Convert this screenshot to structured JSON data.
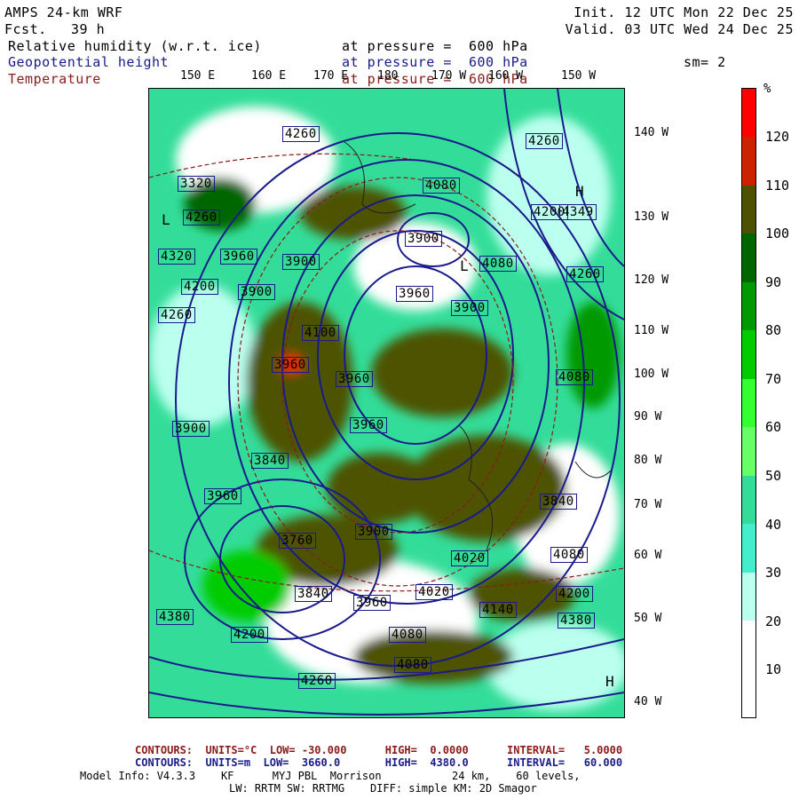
{
  "header": {
    "model": "AMPS 24-km WRF",
    "fcst_label": "Fcst.",
    "fcst_value": "39 h",
    "init": "Init. 12 UTC Mon 22 Dec 25",
    "valid": "Valid. 03 UTC Wed 24 Dec 25",
    "fields": [
      {
        "name": "Relative humidity (w.r.t. ice)",
        "level": "at pressure =  600 hPa",
        "color": "#000000"
      },
      {
        "name": "Geopotential height",
        "level": "at pressure =  600 hPa",
        "color": "#1a1a8c"
      },
      {
        "name": "Temperature",
        "level": "at pressure =  600 hPa",
        "color": "#8b1a1a"
      }
    ],
    "smoothing": "sm= 2"
  },
  "colorbar": {
    "unit": "%",
    "ticks": [
      "120",
      "110",
      "100",
      "90",
      "80",
      "70",
      "60",
      "50",
      "40",
      "30",
      "20",
      "10"
    ],
    "colors": [
      "#ff0000",
      "#cc2200",
      "#4d5200",
      "#006600",
      "#009900",
      "#00cc00",
      "#33ff33",
      "#66ff66",
      "#33dd99",
      "#44eecc",
      "#bbffee",
      "#ffffff",
      "#ffffff"
    ]
  },
  "map": {
    "lon_top": [
      "150 E",
      "160 E",
      "170 E",
      "180",
      "170 W",
      "160 W",
      "150 W"
    ],
    "lon_right": [
      "140 W",
      "130 W",
      "120 W",
      "110 W",
      "100 W",
      "90 W",
      "80 W",
      "70 W",
      "60 W",
      "50 W",
      "40 W"
    ],
    "height_labels": [
      "4260",
      "3320",
      "4260",
      "4320",
      "4200",
      "4260",
      "3900",
      "3960",
      "3900",
      "3840",
      "4100",
      "3960",
      "3960",
      "3900",
      "3960",
      "3960",
      "3900",
      "3960",
      "4080",
      "4080",
      "3900",
      "4260",
      "4380",
      "4200",
      "4380",
      "3840",
      "3960",
      "4020",
      "4140",
      "4080",
      "4200",
      "4260",
      "4080",
      "4080",
      "4020",
      "4200",
      "4260",
      "4080",
      "3840",
      "3900",
      "4349",
      "3760"
    ],
    "extrema": [
      "H",
      "L",
      "L",
      "H"
    ]
  },
  "footer": {
    "temp_line": "CONTOURS:  UNITS=°C  LOW= -30.000      HIGH=  0.0000      INTERVAL=   5.0000",
    "height_line": "CONTOURS:  UNITS=m  LOW=  3660.0       HIGH=  4380.0      INTERVAL=   60.000",
    "model_info": "Model Info: V4.3.3    KF      MYJ PBL  Morrison           24 km,    60 levels,",
    "physics": "LW: RRTM SW: RRTMG    DIFF: simple KM: 2D Smagor"
  }
}
